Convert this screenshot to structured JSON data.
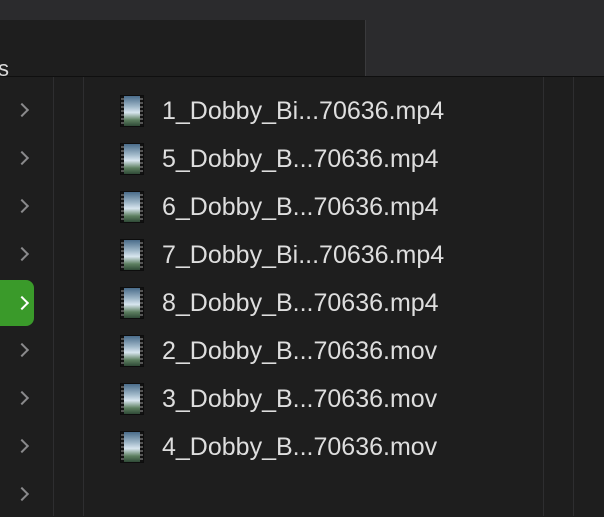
{
  "tab": {
    "label": "s"
  },
  "sidebar": {
    "rows": [
      {
        "selected": false
      },
      {
        "selected": false
      },
      {
        "selected": false
      },
      {
        "selected": false
      },
      {
        "selected": true
      },
      {
        "selected": false
      },
      {
        "selected": false
      },
      {
        "selected": false
      },
      {
        "selected": false
      }
    ],
    "selected_color": "#3a9a2a"
  },
  "files": [
    {
      "name": "1_Dobby_Bi...70636.mp4",
      "icon": "video-thumbnail-icon"
    },
    {
      "name": "5_Dobby_B...70636.mp4",
      "icon": "video-thumbnail-icon"
    },
    {
      "name": "6_Dobby_B...70636.mp4",
      "icon": "video-thumbnail-icon"
    },
    {
      "name": "7_Dobby_Bi...70636.mp4",
      "icon": "video-thumbnail-icon"
    },
    {
      "name": "8_Dobby_B...70636.mp4",
      "icon": "video-thumbnail-icon"
    },
    {
      "name": "2_Dobby_B...70636.mov",
      "icon": "video-thumbnail-icon"
    },
    {
      "name": "3_Dobby_B...70636.mov",
      "icon": "video-thumbnail-icon"
    },
    {
      "name": "4_Dobby_B...70636.mov",
      "icon": "video-thumbnail-icon"
    }
  ]
}
